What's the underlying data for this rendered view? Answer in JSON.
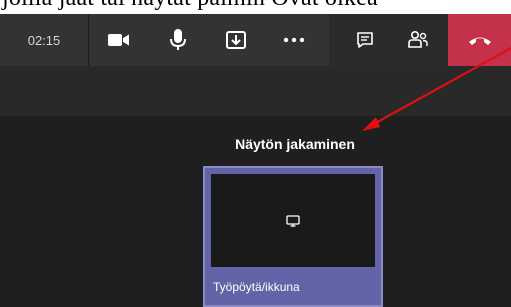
{
  "caption": {
    "text": "joilla jaat tai näytät palmin  Ovat oikea"
  },
  "toolbar": {
    "timer": "02:15",
    "buttons": [
      {
        "name": "camera",
        "icon": "video-camera-icon"
      },
      {
        "name": "microphone",
        "icon": "microphone-icon"
      },
      {
        "name": "share",
        "icon": "share-tray-icon"
      },
      {
        "name": "more",
        "icon": "more-options-icon"
      },
      {
        "name": "chat",
        "icon": "chat-icon"
      },
      {
        "name": "participants",
        "icon": "participants-icon"
      }
    ],
    "hangup_icon": "hang-up-icon",
    "hangup_color": "#c4314b"
  },
  "share_tray": {
    "title": "Näytön jakaminen",
    "tiles": [
      {
        "label": "Työpöytä/ikkuna",
        "icon": "monitor-icon"
      }
    ]
  },
  "annotation": {
    "type": "red-arrow",
    "color": "#e01010"
  }
}
